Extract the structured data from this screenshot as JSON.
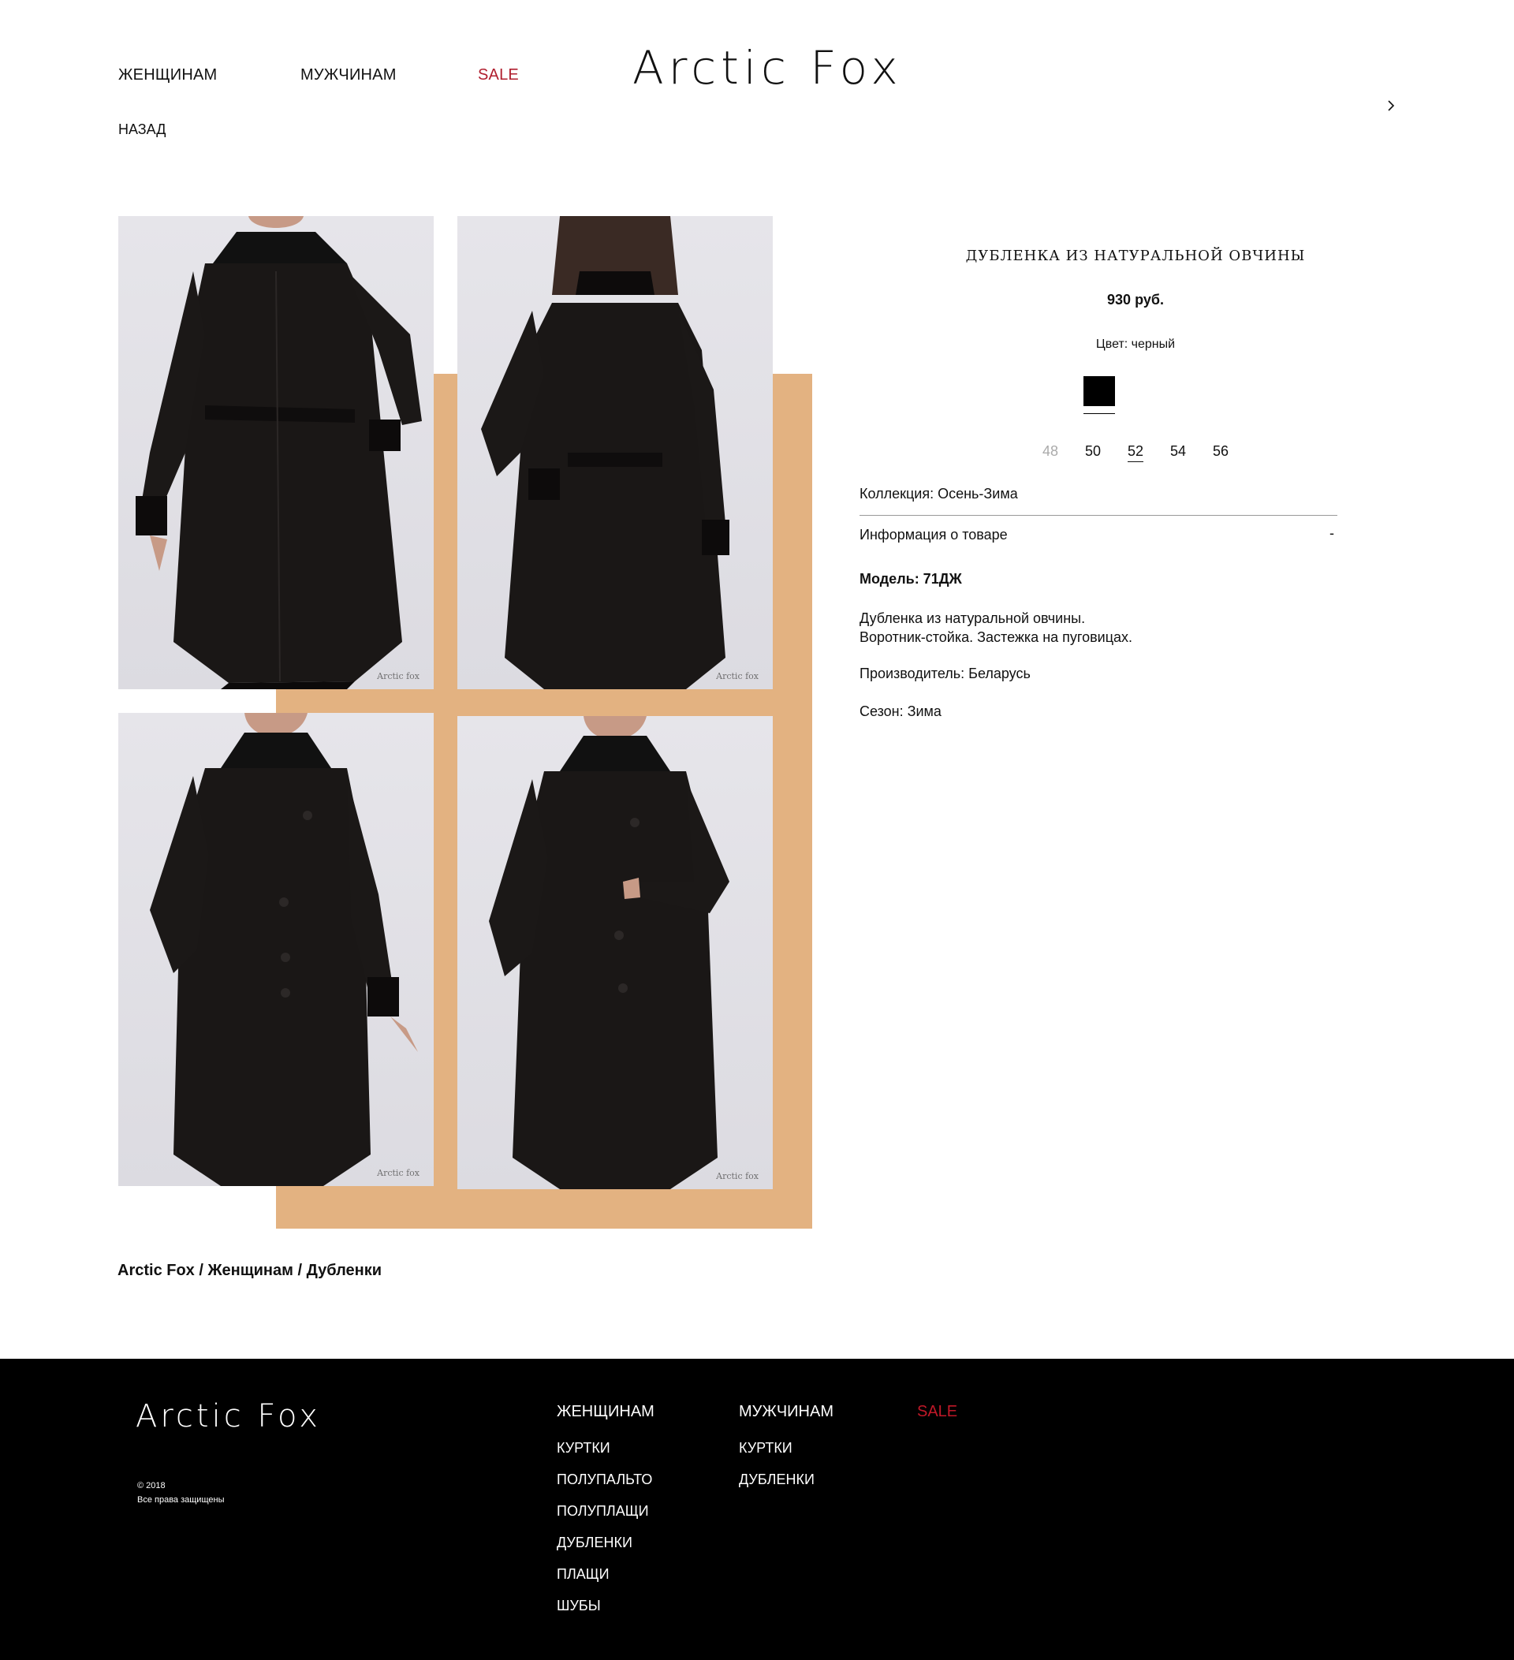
{
  "header": {
    "nav": [
      "ЖЕНЩИНАМ",
      "МУЖЧИНАМ",
      "SALE"
    ],
    "logo": "Arctic Fox",
    "back": "НАЗАД",
    "next_icon": "chevron-right-icon"
  },
  "gallery": {
    "watermark": "Arctic fox",
    "accent_color": "#e3b281"
  },
  "product": {
    "title": "ДУБЛЕНКА ИЗ НАТУРАЛЬНОЙ ОВЧИНЫ",
    "price": "930 руб.",
    "color_label": "Цвет: черный",
    "swatch_color": "#000000",
    "sizes": [
      "48",
      "50",
      "52",
      "54",
      "56"
    ],
    "selected_size": "52",
    "collection": "Коллекция: Осень-Зима",
    "info_toggle": "Информация о товаре",
    "info_toggle_symbol": "-",
    "model": "Модель: 71ДЖ",
    "description_line1": "Дубленка из натуральной овчины.",
    "description_line2": "Воротник-стойка. Застежка на пуговицах.",
    "manufacturer": "Производитель: Беларусь",
    "season": "Сезон: Зима"
  },
  "breadcrumb": {
    "items": [
      "Arctic Fox",
      "Женщинам",
      "Дубленки"
    ],
    "separator": " / "
  },
  "footer": {
    "logo": "Arctic Fox",
    "copyright_line1": "© 2018",
    "copyright_line2": "Все права защищены",
    "women": {
      "title": "ЖЕНЩИНАМ",
      "items": [
        "КУРТКИ",
        "ПОЛУПАЛЬТО",
        "ПОЛУПЛАЩИ",
        "ДУБЛЕНКИ",
        "ПЛАЩИ",
        "ШУБЫ"
      ]
    },
    "men": {
      "title": "МУЖЧИНАМ",
      "items": [
        "КУРТКИ",
        "ДУБЛЕНКИ"
      ]
    },
    "sale": {
      "title": "SALE"
    },
    "sale_color": "#c01828"
  }
}
